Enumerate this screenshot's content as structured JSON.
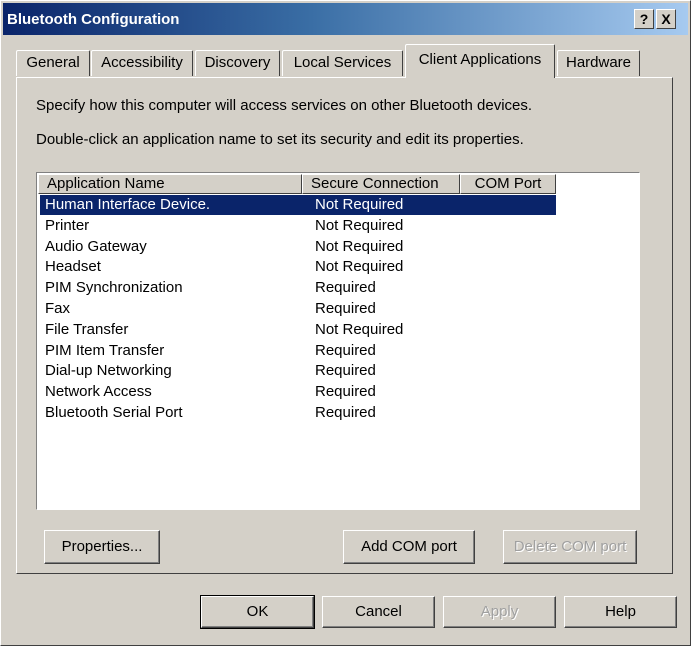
{
  "window": {
    "title": "Bluetooth Configuration",
    "help_glyph": "?",
    "close_glyph": "X"
  },
  "tabs": [
    {
      "label": "General",
      "active": false
    },
    {
      "label": "Accessibility",
      "active": false
    },
    {
      "label": "Discovery",
      "active": false
    },
    {
      "label": "Local Services",
      "active": false
    },
    {
      "label": "Client Applications",
      "active": true
    },
    {
      "label": "Hardware",
      "active": false
    }
  ],
  "panel": {
    "instruction1": "Specify how this computer will access services on other Bluetooth devices.",
    "instruction2": "Double-click an application name to set its security and edit its properties."
  },
  "table": {
    "columns": [
      "Application Name",
      "Secure Connection",
      "COM Port"
    ],
    "rows": [
      {
        "name": "Human Interface Device.",
        "secure": "Not Required",
        "com": "",
        "selected": true
      },
      {
        "name": "Printer",
        "secure": "Not Required",
        "com": ""
      },
      {
        "name": "Audio Gateway",
        "secure": "Not Required",
        "com": ""
      },
      {
        "name": "Headset",
        "secure": "Not Required",
        "com": ""
      },
      {
        "name": "PIM Synchronization",
        "secure": "Required",
        "com": ""
      },
      {
        "name": "Fax",
        "secure": "Required",
        "com": ""
      },
      {
        "name": "File Transfer",
        "secure": "Not Required",
        "com": ""
      },
      {
        "name": "PIM Item Transfer",
        "secure": "Required",
        "com": ""
      },
      {
        "name": "Dial-up Networking",
        "secure": "Required",
        "com": ""
      },
      {
        "name": "Network Access",
        "secure": "Required",
        "com": ""
      },
      {
        "name": "Bluetooth Serial Port",
        "secure": "Required",
        "com": ""
      }
    ]
  },
  "panel_buttons": {
    "properties": "Properties...",
    "add_com": "Add COM port",
    "delete_com": "Delete COM port"
  },
  "dialog_buttons": {
    "ok": "OK",
    "cancel": "Cancel",
    "apply": "Apply",
    "help": "Help"
  },
  "colors": {
    "selection": "#0a246a",
    "face": "#d4d0c8"
  }
}
